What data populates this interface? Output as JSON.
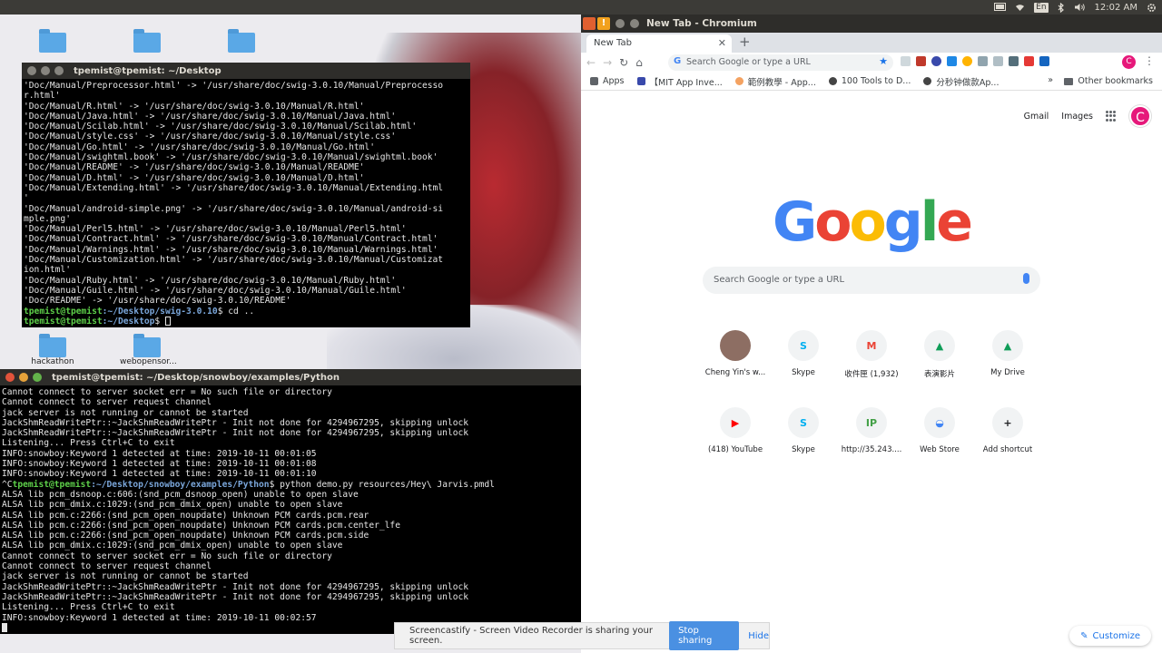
{
  "system_bar": {
    "keyboard_layout": "En",
    "clock": "12:02 AM"
  },
  "desktop": {
    "icons": [
      {
        "label": ""
      },
      {
        "label": ""
      },
      {
        "label": ""
      },
      {
        "label": "hackathon"
      },
      {
        "label": "webopensor..."
      }
    ]
  },
  "terminal1": {
    "title": "tpemist@tpemist: ~/Desktop",
    "lines": [
      "'Doc/Manual/Preprocessor.html' -> '/usr/share/doc/swig-3.0.10/Manual/Preprocesso",
      "r.html'",
      "'Doc/Manual/R.html' -> '/usr/share/doc/swig-3.0.10/Manual/R.html'",
      "'Doc/Manual/Java.html' -> '/usr/share/doc/swig-3.0.10/Manual/Java.html'",
      "'Doc/Manual/Scilab.html' -> '/usr/share/doc/swig-3.0.10/Manual/Scilab.html'",
      "'Doc/Manual/style.css' -> '/usr/share/doc/swig-3.0.10/Manual/style.css'",
      "'Doc/Manual/Go.html' -> '/usr/share/doc/swig-3.0.10/Manual/Go.html'",
      "'Doc/Manual/swightml.book' -> '/usr/share/doc/swig-3.0.10/Manual/swightml.book'",
      "'Doc/Manual/README' -> '/usr/share/doc/swig-3.0.10/Manual/README'",
      "'Doc/Manual/D.html' -> '/usr/share/doc/swig-3.0.10/Manual/D.html'",
      "'Doc/Manual/Extending.html' -> '/usr/share/doc/swig-3.0.10/Manual/Extending.html",
      "'",
      "'Doc/Manual/android-simple.png' -> '/usr/share/doc/swig-3.0.10/Manual/android-si",
      "mple.png'",
      "'Doc/Manual/Perl5.html' -> '/usr/share/doc/swig-3.0.10/Manual/Perl5.html'",
      "'Doc/Manual/Contract.html' -> '/usr/share/doc/swig-3.0.10/Manual/Contract.html'",
      "'Doc/Manual/Warnings.html' -> '/usr/share/doc/swig-3.0.10/Manual/Warnings.html'",
      "'Doc/Manual/Customization.html' -> '/usr/share/doc/swig-3.0.10/Manual/Customizat",
      "ion.html'",
      "'Doc/Manual/Ruby.html' -> '/usr/share/doc/swig-3.0.10/Manual/Ruby.html'",
      "'Doc/Manual/Guile.html' -> '/usr/share/doc/swig-3.0.10/Manual/Guile.html'",
      "'Doc/README' -> '/usr/share/doc/swig-3.0.10/README'"
    ],
    "prompt1": {
      "user": "tpemist@tpemist",
      "path": ":~/Desktop/swig-3.0.10",
      "cmd": "$ cd .."
    },
    "prompt2": {
      "user": "tpemist@tpemist",
      "path": ":~/Desktop",
      "cmd": "$ "
    }
  },
  "terminal2": {
    "title": "tpemist@tpemist: ~/Desktop/snowboy/examples/Python",
    "lines_a": [
      "Cannot connect to server socket err = No such file or directory",
      "Cannot connect to server request channel",
      "jack server is not running or cannot be started",
      "JackShmReadWritePtr::~JackShmReadWritePtr - Init not done for 4294967295, skipping unlock",
      "JackShmReadWritePtr::~JackShmReadWritePtr - Init not done for 4294967295, skipping unlock",
      "Listening... Press Ctrl+C to exit",
      "INFO:snowboy:Keyword 1 detected at time: 2019-10-11 00:01:05",
      "INFO:snowboy:Keyword 1 detected at time: 2019-10-11 00:01:08",
      "INFO:snowboy:Keyword 1 detected at time: 2019-10-11 00:01:10"
    ],
    "prompt": {
      "ctrl": "^C",
      "user": "tpemist@tpemist",
      "path": ":~/Desktop/snowboy/examples/Python",
      "cmd": "$ python demo.py resources/Hey\\ Jarvis.pmdl"
    },
    "lines_b": [
      "ALSA lib pcm_dsnoop.c:606:(snd_pcm_dsnoop_open) unable to open slave",
      "ALSA lib pcm_dmix.c:1029:(snd_pcm_dmix_open) unable to open slave",
      "ALSA lib pcm.c:2266:(snd_pcm_open_noupdate) Unknown PCM cards.pcm.rear",
      "ALSA lib pcm.c:2266:(snd_pcm_open_noupdate) Unknown PCM cards.pcm.center_lfe",
      "ALSA lib pcm.c:2266:(snd_pcm_open_noupdate) Unknown PCM cards.pcm.side",
      "ALSA lib pcm_dmix.c:1029:(snd_pcm_dmix_open) unable to open slave",
      "Cannot connect to server socket err = No such file or directory",
      "Cannot connect to server request channel",
      "jack server is not running or cannot be started",
      "JackShmReadWritePtr::~JackShmReadWritePtr - Init not done for 4294967295, skipping unlock",
      "JackShmReadWritePtr::~JackShmReadWritePtr - Init not done for 4294967295, skipping unlock",
      "Listening... Press Ctrl+C to exit",
      "INFO:snowboy:Keyword 1 detected at time: 2019-10-11 00:02:57"
    ]
  },
  "browser": {
    "window_title": "New Tab - Chromium",
    "tab_label": "New Tab",
    "omnibox_placeholder": "Search Google or type a URL",
    "avatar_letter": "C",
    "bookmarks": [
      {
        "label": "Apps",
        "color": "#5f6368"
      },
      {
        "label": "【MIT App Inve...",
        "color": "#3949ab"
      },
      {
        "label": "範例教學 - App...",
        "color": "#f4a261"
      },
      {
        "label": "100 Tools to D...",
        "color": "#444444"
      },
      {
        "label": "分秒钟做款Ap...",
        "color": "#444444"
      }
    ],
    "other_bookmarks": "Other bookmarks",
    "header_links": {
      "gmail": "Gmail",
      "images": "Images"
    },
    "logo_letters": [
      {
        "ch": "G",
        "color": "#4285f4"
      },
      {
        "ch": "o",
        "color": "#ea4335"
      },
      {
        "ch": "o",
        "color": "#fbbc05"
      },
      {
        "ch": "g",
        "color": "#4285f4"
      },
      {
        "ch": "l",
        "color": "#34a853"
      },
      {
        "ch": "e",
        "color": "#ea4335"
      }
    ],
    "search_placeholder": "Search Google or type a URL",
    "shortcuts": [
      {
        "label": "Cheng Yin's w...",
        "glyph": "",
        "color": "#8d6e63"
      },
      {
        "label": "Skype",
        "glyph": "S",
        "color": "#00aff0"
      },
      {
        "label": "收件匣 (1,932)",
        "glyph": "M",
        "color": "#ea4335"
      },
      {
        "label": "表演影片",
        "glyph": "▲",
        "color": "#0f9d58"
      },
      {
        "label": "My Drive",
        "glyph": "▲",
        "color": "#0f9d58"
      },
      {
        "label": "(418) YouTube",
        "glyph": "▶",
        "color": "#ff0000"
      },
      {
        "label": "Skype",
        "glyph": "S",
        "color": "#00aff0"
      },
      {
        "label": "http://35.243....",
        "glyph": "IP",
        "color": "#43a047"
      },
      {
        "label": "Web Store",
        "glyph": "◒",
        "color": "#4285f4"
      },
      {
        "label": "Add shortcut",
        "glyph": "+",
        "color": "#202124"
      }
    ],
    "customize_label": "Customize"
  },
  "share_bar": {
    "message": "Screencastify - Screen Video Recorder is sharing your screen.",
    "stop_label": "Stop sharing",
    "hide_label": "Hide"
  }
}
